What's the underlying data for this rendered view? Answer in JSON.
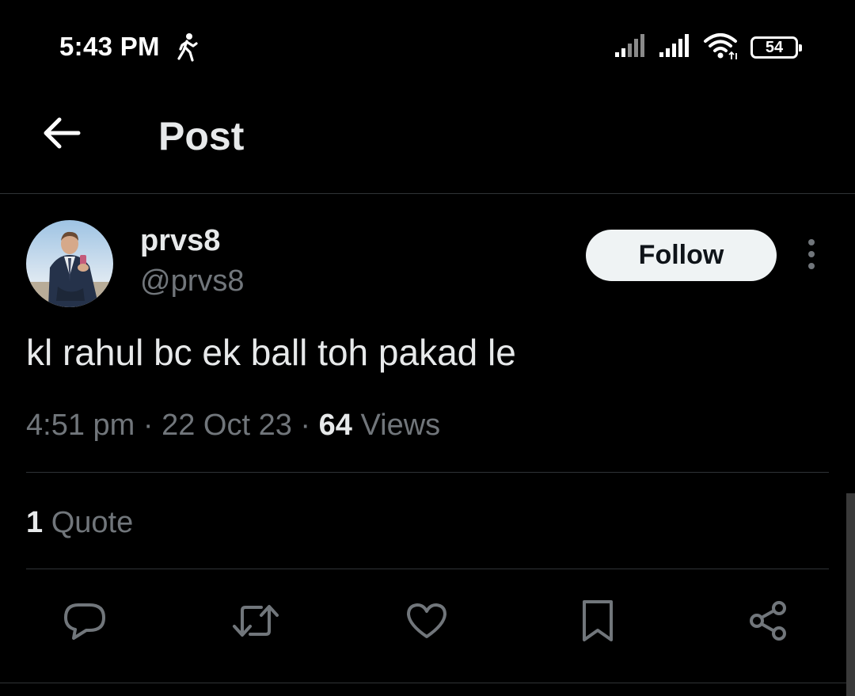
{
  "status_bar": {
    "time": "5:43 PM",
    "battery": "54",
    "icons": [
      "walking-icon",
      "signal-icon",
      "signal-icon",
      "wifi-icon",
      "battery-icon"
    ]
  },
  "header": {
    "title": "Post",
    "back_icon": "arrow-left-icon"
  },
  "post": {
    "display_name": "prvs8",
    "handle": "@prvs8",
    "follow_label": "Follow",
    "text": "kl rahul bc ek ball toh pakad le",
    "time": "4:51 pm",
    "separator": "·",
    "date": "22 Oct 23",
    "views_count": "64",
    "views_label": "Views",
    "quote_count": "1",
    "quote_label": "Quote"
  },
  "actions": [
    {
      "name": "reply",
      "icon": "comment-icon"
    },
    {
      "name": "repost",
      "icon": "repost-icon"
    },
    {
      "name": "like",
      "icon": "heart-icon"
    },
    {
      "name": "bookmark",
      "icon": "bookmark-icon"
    },
    {
      "name": "share",
      "icon": "share-icon"
    }
  ],
  "colors": {
    "background": "#000000",
    "text_primary": "#e7e9ea",
    "text_secondary": "#71767b",
    "divider": "#2f3336",
    "follow_button_bg": "#eff3f4",
    "follow_button_text": "#0f1419"
  }
}
